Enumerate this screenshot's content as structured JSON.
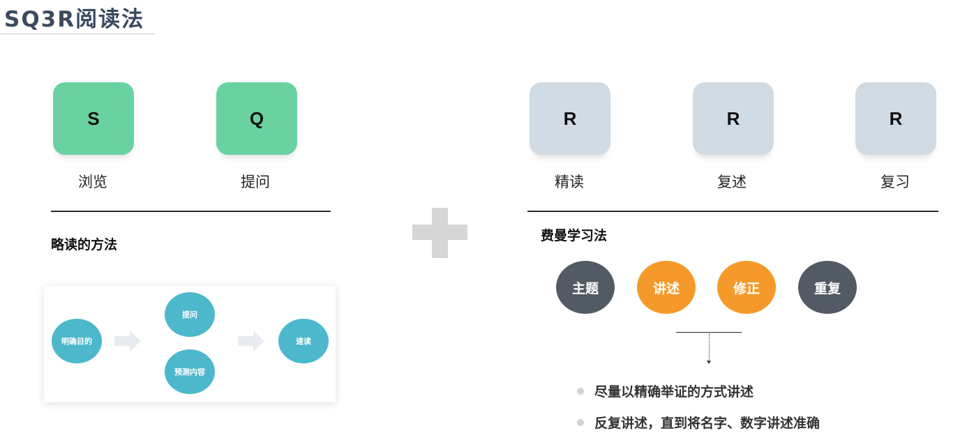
{
  "header": {
    "title": "SQ3R阅读法"
  },
  "left": {
    "tiles": [
      {
        "letter": "S",
        "label": "浏览"
      },
      {
        "letter": "Q",
        "label": "提问"
      }
    ],
    "section_title": "略读的方法",
    "flow": {
      "start": "明确目的",
      "middle": [
        "提问",
        "预测内容"
      ],
      "end": "速读"
    }
  },
  "right": {
    "tiles": [
      {
        "letter": "R",
        "label": "精读"
      },
      {
        "letter": "R",
        "label": "复述"
      },
      {
        "letter": "R",
        "label": "复习"
      }
    ],
    "section_title": "费曼学习法",
    "steps": [
      "主题",
      "讲述",
      "修正",
      "重复"
    ],
    "bullets": [
      "尽量以精确举证的方式讲述",
      "反复讲述，直到将名字、数字讲述准确"
    ]
  },
  "colors": {
    "green_tile": "#69d2a0",
    "gray_tile": "#d1dbe3",
    "flow_node": "#4db8cb",
    "step_dark": "#525a64",
    "step_orange": "#f59a2a"
  }
}
